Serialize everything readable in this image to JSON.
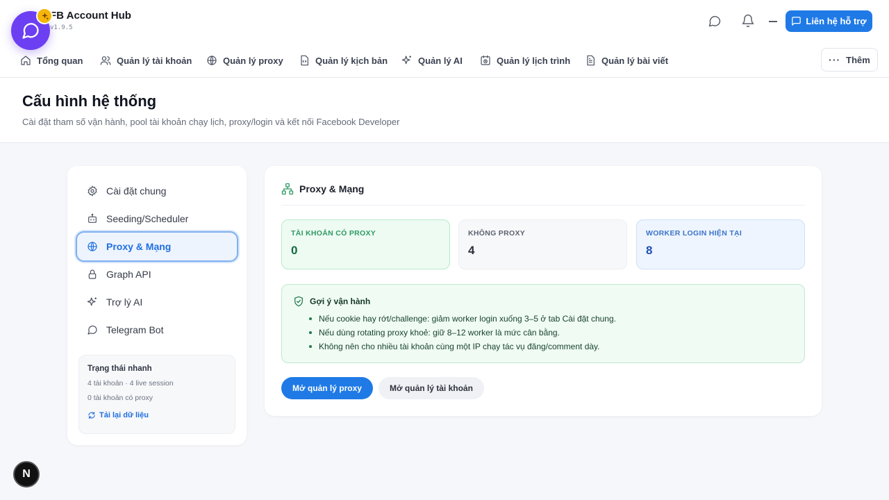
{
  "app": {
    "title": "FB Account Hub",
    "version": "v1.9.5",
    "support_label": "Liên hệ hỗ trợ"
  },
  "nav": {
    "items": [
      {
        "label": "Tổng quan",
        "icon": "home-icon"
      },
      {
        "label": "Quản lý tài khoản",
        "icon": "users-icon"
      },
      {
        "label": "Quản lý proxy",
        "icon": "globe-icon"
      },
      {
        "label": "Quản lý kịch bản",
        "icon": "script-file-icon"
      },
      {
        "label": "Quản lý AI",
        "icon": "sparkles-icon"
      },
      {
        "label": "Quản lý lịch trình",
        "icon": "calendar-clock-icon"
      },
      {
        "label": "Quản lý bài viết",
        "icon": "document-icon"
      }
    ],
    "more_label": "Thêm"
  },
  "page": {
    "title": "Cấu hình hệ thống",
    "subtitle": "Cài đặt tham số vận hành, pool tài khoản chạy lịch, proxy/login và kết nối Facebook Developer"
  },
  "sidebar": {
    "items": [
      {
        "label": "Cài đặt chung",
        "icon": "gear-icon",
        "active": false
      },
      {
        "label": "Seeding/Scheduler",
        "icon": "bot-icon",
        "active": false
      },
      {
        "label": "Proxy & Mạng",
        "icon": "globe-icon",
        "active": true
      },
      {
        "label": "Graph API",
        "icon": "lock-icon",
        "active": false
      },
      {
        "label": "Trợ lý AI",
        "icon": "sparkles-icon",
        "active": false
      },
      {
        "label": "Telegram Bot",
        "icon": "message-circle-icon",
        "active": false
      }
    ],
    "status": {
      "title": "Trạng thái nhanh",
      "line1": "4 tài khoản · 4 live session",
      "line2": "0 tài khoản có proxy",
      "reload_label": "Tải lại dữ liệu"
    }
  },
  "panel": {
    "title": "Proxy & Mạng",
    "stats": [
      {
        "label": "TÀI KHOẢN CÓ PROXY",
        "value": "0"
      },
      {
        "label": "KHÔNG PROXY",
        "value": "4"
      },
      {
        "label": "WORKER LOGIN HIỆN TẠI",
        "value": "8"
      }
    ],
    "tips": {
      "title": "Gợi ý vận hành",
      "items": [
        "Nếu cookie hay rớt/challenge: giảm worker login xuống 3–5 ở tab Cài đặt chung.",
        "Nếu dùng rotating proxy khoẻ: giữ 8–12 worker là mức cân bằng.",
        "Không nên cho nhiều tài khoản cùng một IP chạy tác vụ đăng/comment dày."
      ]
    },
    "buttons": {
      "open_proxy": "Mở quản lý proxy",
      "open_accounts": "Mở quản lý tài khoản"
    }
  },
  "floating": {
    "n_badge": "N"
  },
  "colors": {
    "accent": "#1f7ae6",
    "chat_bubble": "#6c3ff2",
    "badge": "#f5b60a"
  }
}
